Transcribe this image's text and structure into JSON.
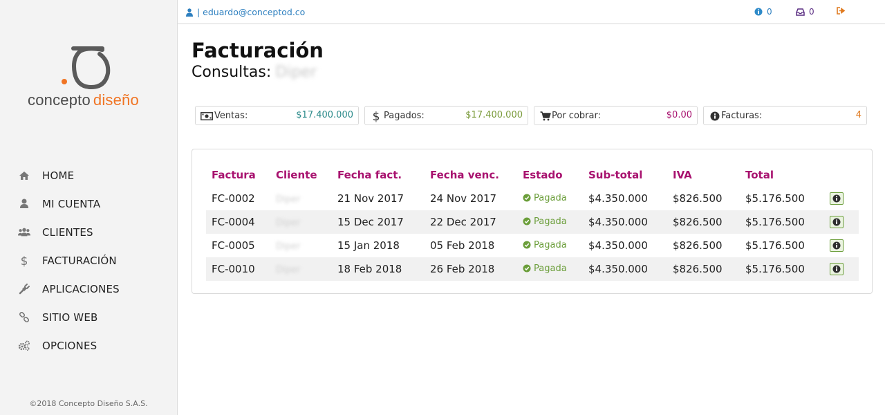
{
  "sidebar": {
    "logo": {
      "text_main": "concepto",
      "text_accent": "diseño"
    },
    "items": [
      {
        "label": "HOME",
        "icon": "home-icon"
      },
      {
        "label": "MI CUENTA",
        "icon": "user-icon"
      },
      {
        "label": "CLIENTES",
        "icon": "users-icon"
      },
      {
        "label": "FACTURACIÓN",
        "icon": "dollar-icon"
      },
      {
        "label": "APLICACIONES",
        "icon": "plug-icon"
      },
      {
        "label": "SITIO WEB",
        "icon": "link-icon"
      },
      {
        "label": "OPCIONES",
        "icon": "gears-icon"
      }
    ],
    "footer": "©2018 Concepto Diseño S.A.S."
  },
  "topbar": {
    "user": "| eduardo@conceptod.co",
    "info_count": "0",
    "inbox_count": "0"
  },
  "page": {
    "title": "Facturación",
    "subtitle_label": "Consultas:",
    "subtitle_value": "Diper"
  },
  "stats": [
    {
      "label": "Ventas:",
      "value": "$17.400.000",
      "icon": "money-icon",
      "color": "#2b8a8a"
    },
    {
      "label": "Pagados:",
      "value": "$17.400.000",
      "icon": "dollar-icon",
      "color": "#7a9a3a"
    },
    {
      "label": "Por cobrar:",
      "value": "$0.00",
      "icon": "cart-icon",
      "color": "#a8126f"
    },
    {
      "label": "Facturas:",
      "value": "4",
      "icon": "info-icon",
      "color": "#e07a1f"
    }
  ],
  "table": {
    "headers": [
      "Factura",
      "Cliente",
      "Fecha fact.",
      "Fecha venc.",
      "Estado",
      "Sub-total",
      "IVA",
      "Total"
    ],
    "rows": [
      {
        "factura": "FC-0002",
        "cliente": "Diper",
        "fecha_fact": "21 Nov 2017",
        "fecha_venc": "24 Nov 2017",
        "estado": "Pagada",
        "subtotal": "$4.350.000",
        "iva": "$826.500",
        "total": "$5.176.500"
      },
      {
        "factura": "FC-0004",
        "cliente": "Diper",
        "fecha_fact": "15 Dec 2017",
        "fecha_venc": "22 Dec 2017",
        "estado": "Pagada",
        "subtotal": "$4.350.000",
        "iva": "$826.500",
        "total": "$5.176.500"
      },
      {
        "factura": "FC-0005",
        "cliente": "Diper",
        "fecha_fact": "15 Jan 2018",
        "fecha_venc": "05 Feb 2018",
        "estado": "Pagada",
        "subtotal": "$4.350.000",
        "iva": "$826.500",
        "total": "$5.176.500"
      },
      {
        "factura": "FC-0010",
        "cliente": "Diper",
        "fecha_fact": "18 Feb 2018",
        "fecha_venc": "26 Feb 2018",
        "estado": "Pagada",
        "subtotal": "$4.350.000",
        "iva": "$826.500",
        "total": "$5.176.500"
      }
    ]
  },
  "colors": {
    "accent_orange": "#f07423",
    "header_magenta": "#a8126f",
    "link_blue": "#2d7fbf",
    "status_green": "#6b9e3a"
  }
}
